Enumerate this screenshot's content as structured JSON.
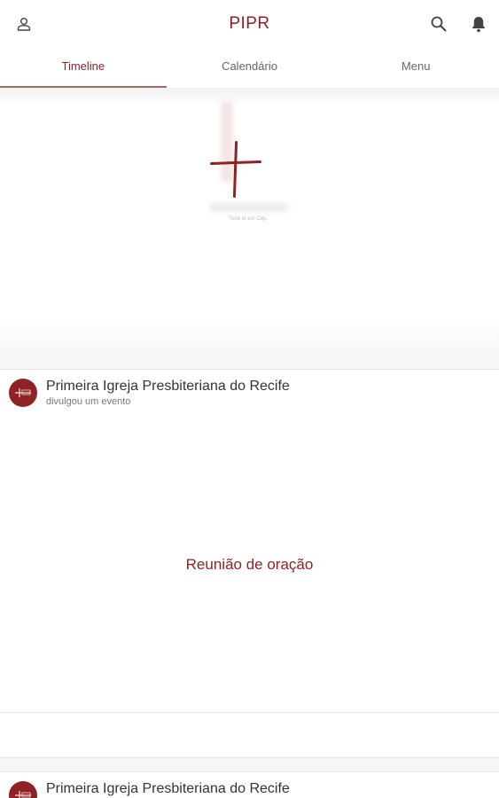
{
  "header": {
    "title": "PIPR",
    "profile_icon": "user-icon",
    "search_icon": "search-icon",
    "notifications_icon": "bell-icon"
  },
  "tabs": [
    {
      "label": "Timeline",
      "active": true
    },
    {
      "label": "Calendário",
      "active": false
    },
    {
      "label": "Menu",
      "active": false
    }
  ],
  "banner": {
    "tagline": "Sola et em Cep."
  },
  "posts": [
    {
      "author": "Primeira Igreja Presbiteriana do Recife",
      "action": "divulgou um evento",
      "event_title": "Reunião de oração"
    },
    {
      "author": "Primeira Igreja Presbiteriana do Recife"
    }
  ],
  "colors": {
    "brand": "#8e2224",
    "tab_indicator": "#a46a6b"
  }
}
